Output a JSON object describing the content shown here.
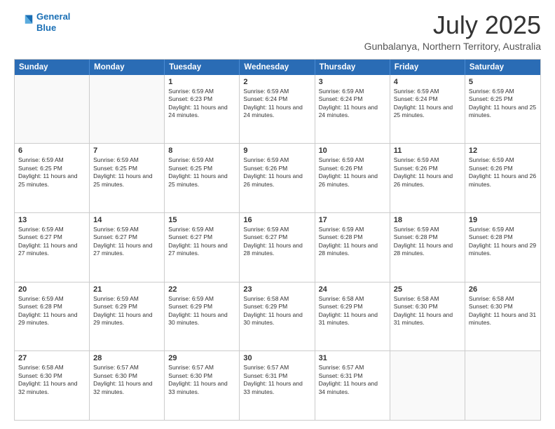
{
  "header": {
    "logo_line1": "General",
    "logo_line2": "Blue",
    "title": "July 2025",
    "subtitle": "Gunbalanya, Northern Territory, Australia"
  },
  "days_of_week": [
    "Sunday",
    "Monday",
    "Tuesday",
    "Wednesday",
    "Thursday",
    "Friday",
    "Saturday"
  ],
  "weeks": [
    [
      {
        "day": "",
        "empty": true
      },
      {
        "day": "",
        "empty": true
      },
      {
        "day": "1",
        "sunrise": "6:59 AM",
        "sunset": "6:23 PM",
        "daylight": "11 hours and 24 minutes."
      },
      {
        "day": "2",
        "sunrise": "6:59 AM",
        "sunset": "6:24 PM",
        "daylight": "11 hours and 24 minutes."
      },
      {
        "day": "3",
        "sunrise": "6:59 AM",
        "sunset": "6:24 PM",
        "daylight": "11 hours and 24 minutes."
      },
      {
        "day": "4",
        "sunrise": "6:59 AM",
        "sunset": "6:24 PM",
        "daylight": "11 hours and 25 minutes."
      },
      {
        "day": "5",
        "sunrise": "6:59 AM",
        "sunset": "6:25 PM",
        "daylight": "11 hours and 25 minutes."
      }
    ],
    [
      {
        "day": "6",
        "sunrise": "6:59 AM",
        "sunset": "6:25 PM",
        "daylight": "11 hours and 25 minutes."
      },
      {
        "day": "7",
        "sunrise": "6:59 AM",
        "sunset": "6:25 PM",
        "daylight": "11 hours and 25 minutes."
      },
      {
        "day": "8",
        "sunrise": "6:59 AM",
        "sunset": "6:25 PM",
        "daylight": "11 hours and 25 minutes."
      },
      {
        "day": "9",
        "sunrise": "6:59 AM",
        "sunset": "6:26 PM",
        "daylight": "11 hours and 26 minutes."
      },
      {
        "day": "10",
        "sunrise": "6:59 AM",
        "sunset": "6:26 PM",
        "daylight": "11 hours and 26 minutes."
      },
      {
        "day": "11",
        "sunrise": "6:59 AM",
        "sunset": "6:26 PM",
        "daylight": "11 hours and 26 minutes."
      },
      {
        "day": "12",
        "sunrise": "6:59 AM",
        "sunset": "6:26 PM",
        "daylight": "11 hours and 26 minutes."
      }
    ],
    [
      {
        "day": "13",
        "sunrise": "6:59 AM",
        "sunset": "6:27 PM",
        "daylight": "11 hours and 27 minutes."
      },
      {
        "day": "14",
        "sunrise": "6:59 AM",
        "sunset": "6:27 PM",
        "daylight": "11 hours and 27 minutes."
      },
      {
        "day": "15",
        "sunrise": "6:59 AM",
        "sunset": "6:27 PM",
        "daylight": "11 hours and 27 minutes."
      },
      {
        "day": "16",
        "sunrise": "6:59 AM",
        "sunset": "6:27 PM",
        "daylight": "11 hours and 28 minutes."
      },
      {
        "day": "17",
        "sunrise": "6:59 AM",
        "sunset": "6:28 PM",
        "daylight": "11 hours and 28 minutes."
      },
      {
        "day": "18",
        "sunrise": "6:59 AM",
        "sunset": "6:28 PM",
        "daylight": "11 hours and 28 minutes."
      },
      {
        "day": "19",
        "sunrise": "6:59 AM",
        "sunset": "6:28 PM",
        "daylight": "11 hours and 29 minutes."
      }
    ],
    [
      {
        "day": "20",
        "sunrise": "6:59 AM",
        "sunset": "6:28 PM",
        "daylight": "11 hours and 29 minutes."
      },
      {
        "day": "21",
        "sunrise": "6:59 AM",
        "sunset": "6:29 PM",
        "daylight": "11 hours and 29 minutes."
      },
      {
        "day": "22",
        "sunrise": "6:59 AM",
        "sunset": "6:29 PM",
        "daylight": "11 hours and 30 minutes."
      },
      {
        "day": "23",
        "sunrise": "6:58 AM",
        "sunset": "6:29 PM",
        "daylight": "11 hours and 30 minutes."
      },
      {
        "day": "24",
        "sunrise": "6:58 AM",
        "sunset": "6:29 PM",
        "daylight": "11 hours and 31 minutes."
      },
      {
        "day": "25",
        "sunrise": "6:58 AM",
        "sunset": "6:30 PM",
        "daylight": "11 hours and 31 minutes."
      },
      {
        "day": "26",
        "sunrise": "6:58 AM",
        "sunset": "6:30 PM",
        "daylight": "11 hours and 31 minutes."
      }
    ],
    [
      {
        "day": "27",
        "sunrise": "6:58 AM",
        "sunset": "6:30 PM",
        "daylight": "11 hours and 32 minutes."
      },
      {
        "day": "28",
        "sunrise": "6:57 AM",
        "sunset": "6:30 PM",
        "daylight": "11 hours and 32 minutes."
      },
      {
        "day": "29",
        "sunrise": "6:57 AM",
        "sunset": "6:30 PM",
        "daylight": "11 hours and 33 minutes."
      },
      {
        "day": "30",
        "sunrise": "6:57 AM",
        "sunset": "6:31 PM",
        "daylight": "11 hours and 33 minutes."
      },
      {
        "day": "31",
        "sunrise": "6:57 AM",
        "sunset": "6:31 PM",
        "daylight": "11 hours and 34 minutes."
      },
      {
        "day": "",
        "empty": true
      },
      {
        "day": "",
        "empty": true
      }
    ]
  ]
}
